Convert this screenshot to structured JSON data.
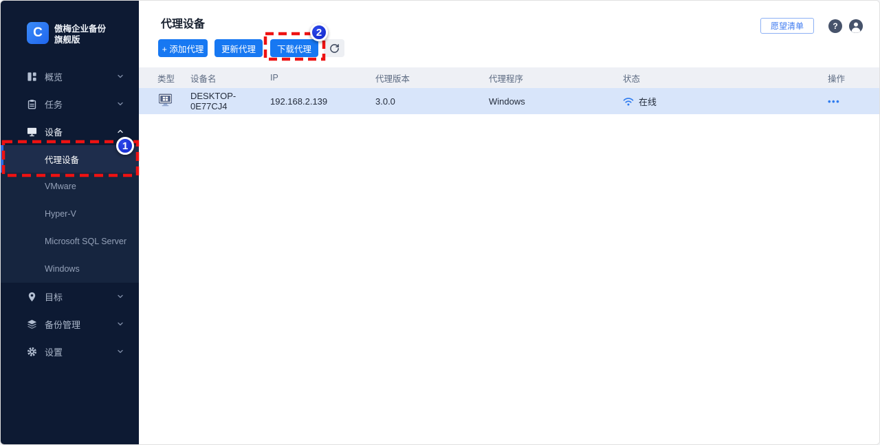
{
  "app": {
    "logo_letter": "C",
    "title_line1": "傲梅企业备份",
    "title_line2": "旗舰版"
  },
  "sidebar": {
    "items": [
      {
        "label": "概览"
      },
      {
        "label": "任务"
      },
      {
        "label": "设备"
      },
      {
        "label": "目标"
      },
      {
        "label": "备份管理"
      },
      {
        "label": "设置"
      }
    ],
    "device_submenu": [
      {
        "label": "代理设备",
        "selected": true
      },
      {
        "label": "VMware"
      },
      {
        "label": "Hyper-V"
      },
      {
        "label": "Microsoft SQL Server"
      },
      {
        "label": "Windows"
      }
    ]
  },
  "header": {
    "page_title": "代理设备",
    "wishlist_label": "愿望清单",
    "help_label": "?"
  },
  "toolbar": {
    "add_label": "+ 添加代理",
    "update_label": "更新代理",
    "download_label": "下载代理"
  },
  "table": {
    "headers": [
      "类型",
      "设备名",
      "IP",
      "代理版本",
      "代理程序",
      "状态",
      "操作"
    ],
    "rows": [
      {
        "type_icon": "windows-monitor-icon",
        "device_name": "DESKTOP-0E77CJ4",
        "ip": "192.168.2.139",
        "agent_version": "3.0.0",
        "agent_program": "Windows",
        "status": "在线",
        "actions_label": "•••"
      }
    ]
  },
  "annotations": {
    "step1": "1",
    "step2": "2"
  },
  "colors": {
    "accent_blue": "#1778f2",
    "annotation_red": "#ee1212",
    "badge_blue": "#1a2fd0",
    "sidebar_bg": "#0d1a33",
    "submenu_bg": "#16253f",
    "selected_item_bg": "#1e2d4c",
    "row_highlight": "#d8e5fa",
    "table_header_bg": "#eef0f5",
    "status_wifi_blue": "#2e7bef"
  }
}
